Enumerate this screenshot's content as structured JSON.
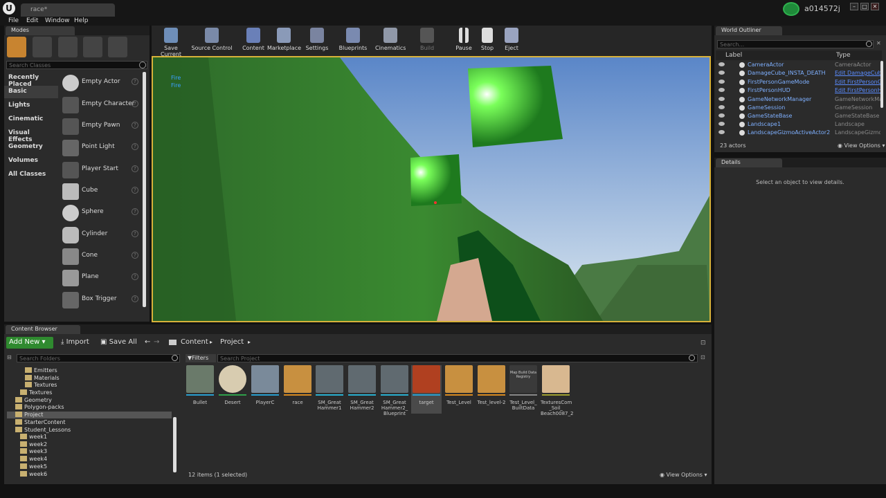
{
  "app": {
    "doc_tab": "race*",
    "user": "a014572j",
    "logo": "U"
  },
  "menu": [
    "File",
    "Edit",
    "Window",
    "Help"
  ],
  "modes": {
    "tab": "Modes",
    "search_placeholder": "Search Classes",
    "categories": [
      "Recently Placed",
      "Basic",
      "Lights",
      "Cinematic",
      "Visual Effects",
      "Geometry",
      "Volumes",
      "All Classes"
    ],
    "actors": [
      "Empty Actor",
      "Empty Character",
      "Empty Pawn",
      "Point Light",
      "Player Start",
      "Cube",
      "Sphere",
      "Cylinder",
      "Cone",
      "Plane",
      "Box Trigger"
    ]
  },
  "toolbar": [
    "Save Current",
    "Source Control",
    "Content",
    "Marketplace",
    "Settings",
    "Blueprints",
    "Cinematics",
    "Build",
    "Pause",
    "Stop",
    "Eject"
  ],
  "viewport": {
    "log": [
      "Fire",
      "Fire"
    ]
  },
  "outliner": {
    "tab": "World Outliner",
    "search_placeholder": "Search...",
    "col_label": "Label",
    "col_type": "Type",
    "rows": [
      {
        "label": "CameraActor",
        "type": "CameraActor",
        "link": false
      },
      {
        "label": "DamageCube_INSTA_DEATH",
        "type": "Edit DamageCub",
        "link": true
      },
      {
        "label": "FirstPersonGameMode",
        "type": "Edit FirstPersonG",
        "link": true
      },
      {
        "label": "FirstPersonHUD",
        "type": "Edit FirstPersonH",
        "link": true
      },
      {
        "label": "GameNetworkManager",
        "type": "GameNetworkMar",
        "link": false
      },
      {
        "label": "GameSession",
        "type": "GameSession",
        "link": false
      },
      {
        "label": "GameStateBase",
        "type": "GameStateBase",
        "link": false
      },
      {
        "label": "Landscape1",
        "type": "Landscape",
        "link": false
      },
      {
        "label": "LandscapeGizmoActiveActor2",
        "type": "LandscapeGizmo",
        "link": false
      }
    ],
    "count": "23 actors",
    "view_options": "View Options"
  },
  "details": {
    "tab": "Details",
    "empty": "Select an object to view details."
  },
  "content_browser": {
    "tab": "Content Browser",
    "add_new": "Add New",
    "import": "Import",
    "save_all": "Save All",
    "path": [
      "Content",
      "Project"
    ],
    "folder_search": "Search Folders",
    "filters": "Filters",
    "search_project": "Search Project",
    "folders": [
      {
        "name": "Emitters",
        "indent": 2
      },
      {
        "name": "Materials",
        "indent": 2
      },
      {
        "name": "Textures",
        "indent": 2
      },
      {
        "name": "Textures",
        "indent": 1
      },
      {
        "name": "Geometry",
        "indent": 0
      },
      {
        "name": "Polygon-packs",
        "indent": 0
      },
      {
        "name": "Project",
        "indent": 0
      },
      {
        "name": "StarterContent",
        "indent": 0
      },
      {
        "name": "Student_Lessons",
        "indent": 0
      },
      {
        "name": "week1",
        "indent": 1
      },
      {
        "name": "week2",
        "indent": 1
      },
      {
        "name": "week3",
        "indent": 1
      },
      {
        "name": "week4",
        "indent": 1
      },
      {
        "name": "week5",
        "indent": 1
      },
      {
        "name": "week6",
        "indent": 1
      }
    ],
    "assets": [
      {
        "name": "Bullet",
        "color": "#6a7a6a",
        "bar": "#29a0d0"
      },
      {
        "name": "Desert",
        "color": "#d8ccb0",
        "bar": "#2fa04a"
      },
      {
        "name": "PlayerC",
        "color": "#7a8a9a",
        "bar": "#29a0d0"
      },
      {
        "name": "race",
        "color": "#c89040",
        "bar": "#d88a20"
      },
      {
        "name": "SM_Great Hammer1",
        "color": "#606a70",
        "bar": "#29b0d0"
      },
      {
        "name": "SM_Great Hammer2",
        "color": "#606a70",
        "bar": "#29b0d0"
      },
      {
        "name": "SM_Great Hammer2_ Blueprint",
        "color": "#606a70",
        "bar": "#29b0d0"
      },
      {
        "name": "target",
        "color": "#b04020",
        "bar": "#29a0d0"
      },
      {
        "name": "Test_Level",
        "color": "#c89040",
        "bar": "#d88a20"
      },
      {
        "name": "Test_level-2",
        "color": "#c89040",
        "bar": "#d88a20"
      },
      {
        "name": "Test_Level_ BuiltData",
        "color": "#3a3a3a",
        "bar": "#888888"
      },
      {
        "name": "TexturesCom _Soil_ Beach0087_2",
        "color": "#d8b890",
        "bar": "#a0a030"
      }
    ],
    "map_build_label": "Map Build Data Registry",
    "status": "12 items (1 selected)",
    "view_options": "View Options"
  }
}
